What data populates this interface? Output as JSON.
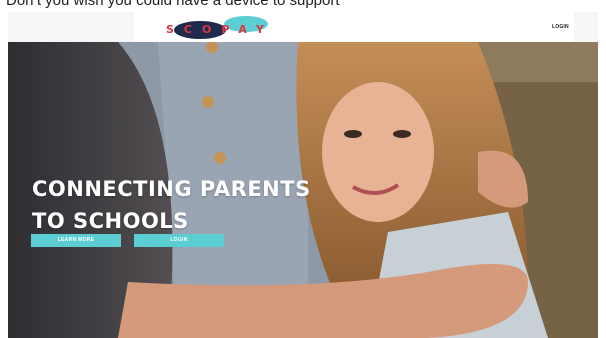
{
  "top_strip": {
    "text": "Don’t you wish you could have a device to support"
  },
  "header": {
    "logo_text": "SCOPAY",
    "login_label": "LOGIN"
  },
  "hero": {
    "headline_line1": "CONNECTING PARENTS",
    "headline_line2": "TO SCHOOLS",
    "learn_more_label": "LEARN MORE",
    "login_button_label": "LOGIN"
  },
  "colors": {
    "accent_teal": "#5ccdd2",
    "logo_red": "#d9373f",
    "logo_navy": "#1f2a4d"
  }
}
